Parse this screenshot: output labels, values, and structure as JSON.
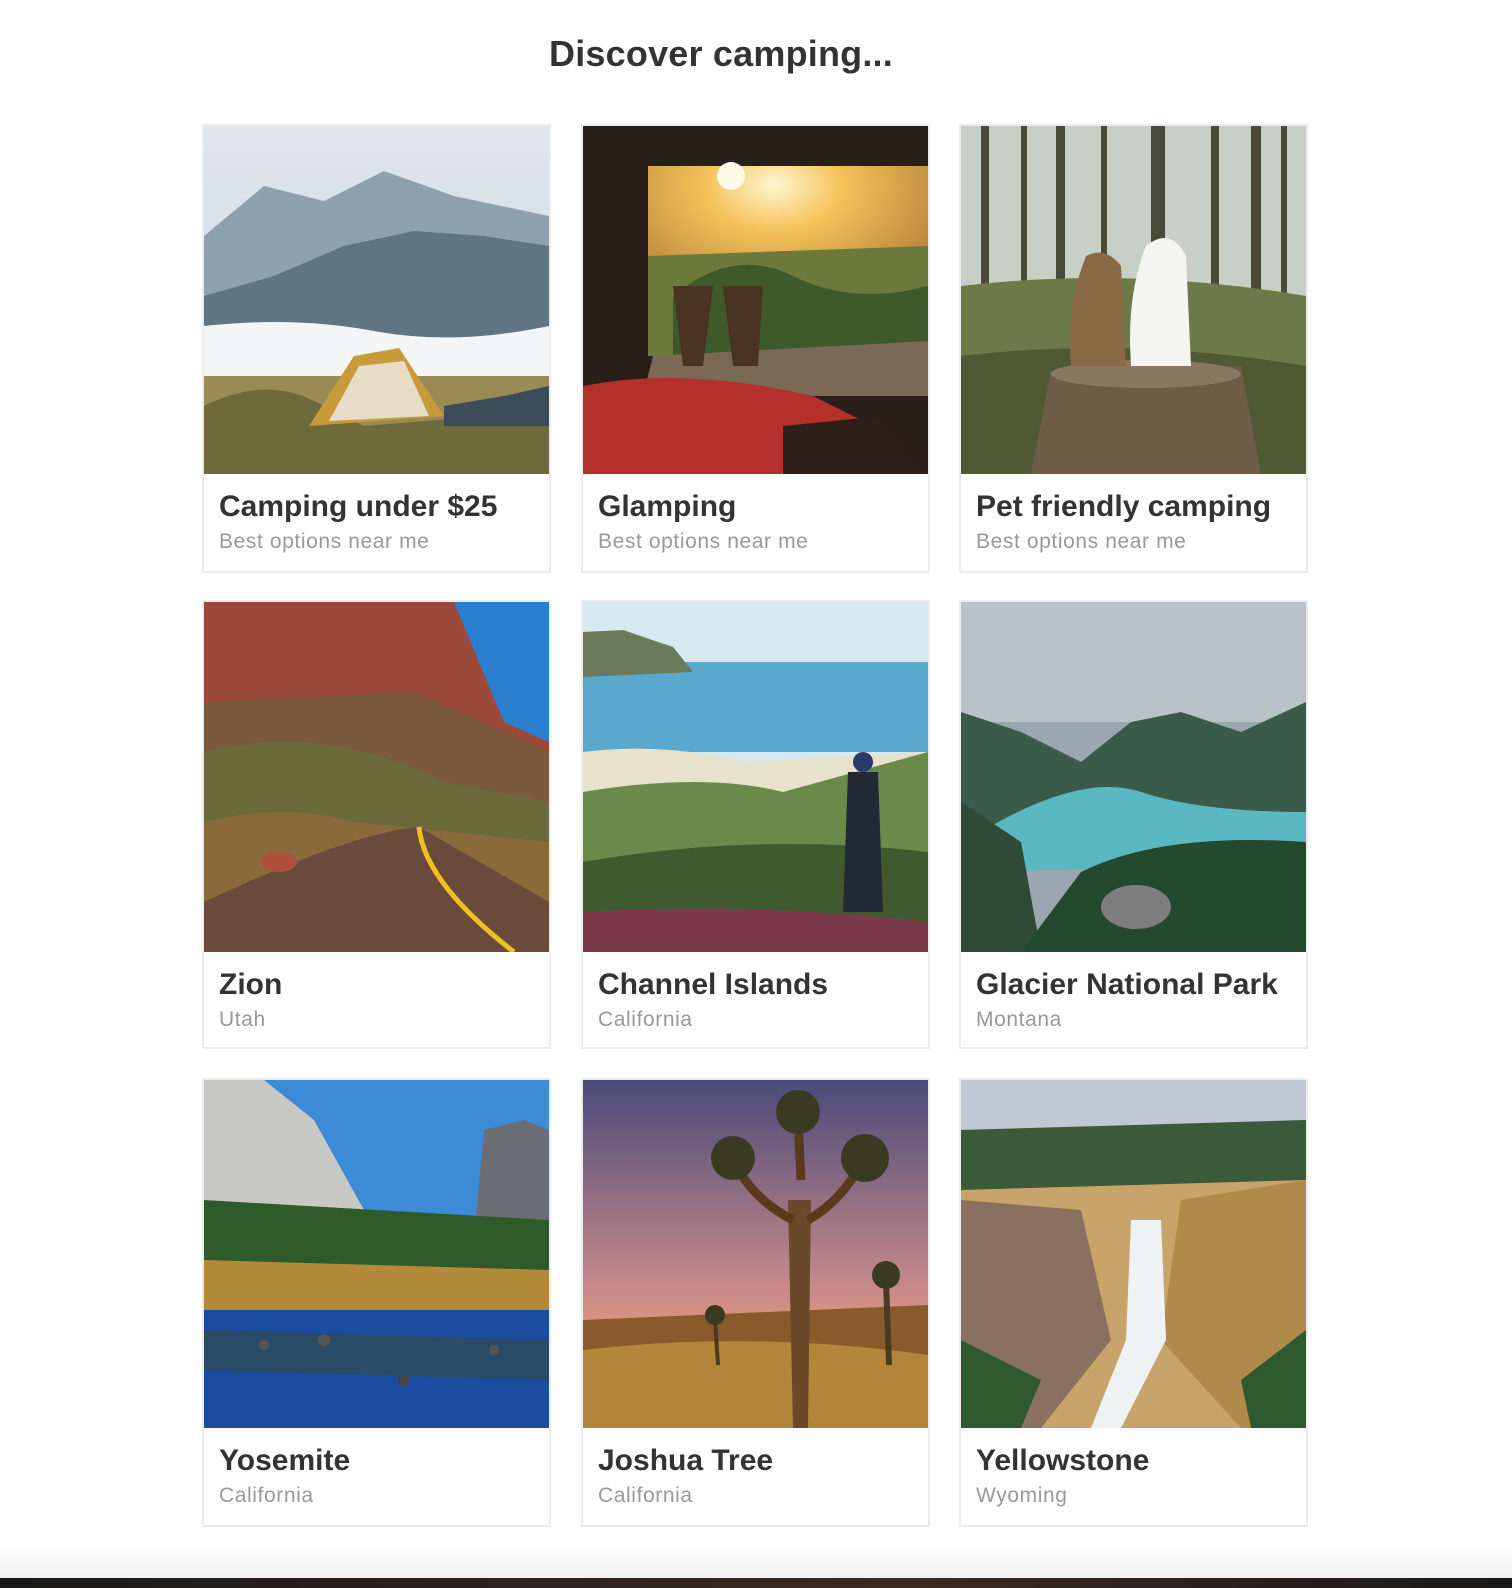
{
  "header": {
    "title": "Discover camping..."
  },
  "cards": [
    {
      "name": "Camping under $25",
      "subtitle": "Best options near me",
      "image": "mountain-tent-photo"
    },
    {
      "name": "Glamping",
      "subtitle": "Best options near me",
      "image": "glamping-sunset-deck-photo"
    },
    {
      "name": "Pet friendly camping",
      "subtitle": "Best options near me",
      "image": "dogs-forest-stump-photo"
    },
    {
      "name": "Zion",
      "subtitle": "Utah",
      "image": "zion-canyon-road-photo"
    },
    {
      "name": "Channel Islands",
      "subtitle": "California",
      "image": "coast-hikers-photo"
    },
    {
      "name": "Glacier National Park",
      "subtitle": "Montana",
      "image": "glacier-lake-photo"
    },
    {
      "name": "Yosemite",
      "subtitle": "California",
      "image": "yosemite-river-photo"
    },
    {
      "name": "Joshua Tree",
      "subtitle": "California",
      "image": "joshua-tree-sunset-photo"
    },
    {
      "name": "Yellowstone",
      "subtitle": "Wyoming",
      "image": "yellowstone-falls-photo"
    }
  ]
}
